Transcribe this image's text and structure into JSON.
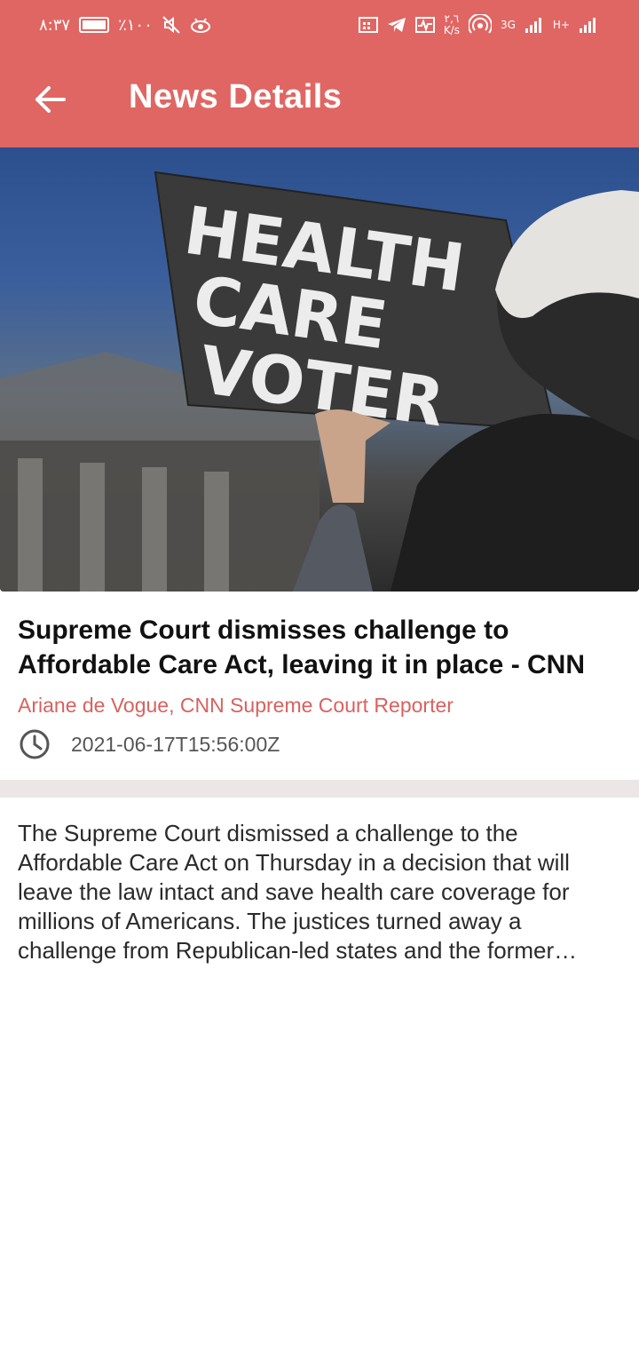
{
  "status_bar": {
    "time": "٨:٣٧",
    "battery_percent": "٪١٠٠",
    "net_speed_value": "٢,٦",
    "net_speed_unit": "K/s",
    "sim1_label": "3G",
    "sim2_label": "H+"
  },
  "toolbar": {
    "title": "News Details"
  },
  "article": {
    "image_sign_text": [
      "HEALTH",
      "CARE",
      "VOTER"
    ],
    "title": "Supreme Court dismisses challenge to Affordable Care Act, leaving it in place - CNN",
    "author": "Ariane de Vogue, CNN Supreme Court Reporter",
    "published_at": "2021-06-17T15:56:00Z",
    "description": "The Supreme Court dismissed a challenge to the Affordable Care Act on Thursday in a decision that will leave the law intact and save health care coverage for millions of Americans. The justices turned away a challenge from Republican-led states and the former…"
  },
  "colors": {
    "app_bar": "#e06663",
    "author_text": "#d7625f",
    "divider": "#ebe7e6"
  },
  "icons": {
    "back": "arrow-left-icon",
    "clock": "clock-icon"
  }
}
